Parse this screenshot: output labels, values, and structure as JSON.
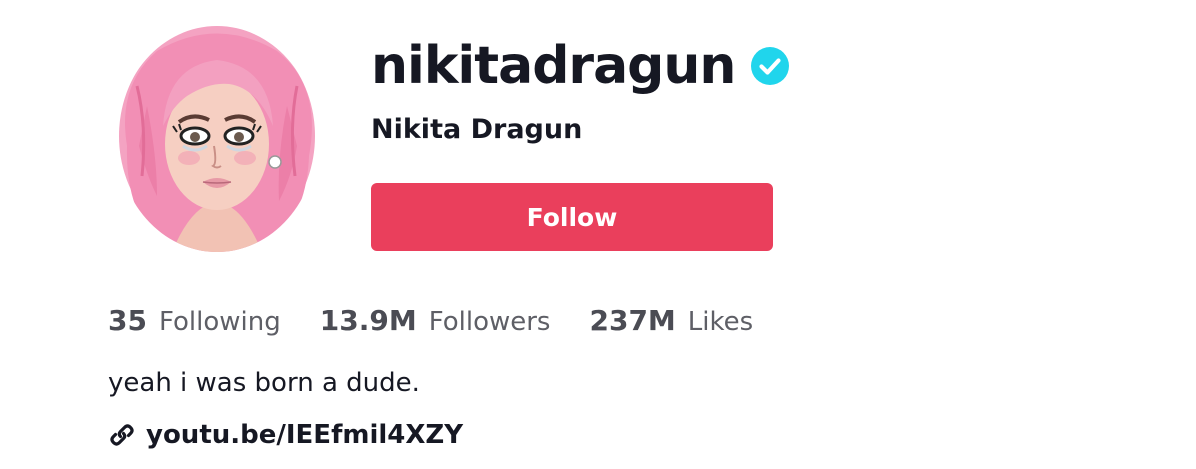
{
  "profile": {
    "username": "nikitadragun",
    "display_name": "Nikita Dragun",
    "verified": true,
    "follow_label": "Follow",
    "bio": "yeah i was born a dude.",
    "link": "youtu.be/IEEfmil4XZY",
    "stats": [
      {
        "count": "35",
        "label": "Following"
      },
      {
        "count": "13.9M",
        "label": "Followers"
      },
      {
        "count": "237M",
        "label": "Likes"
      }
    ]
  },
  "icons": {
    "verified": "verified-check-icon",
    "link": "link-icon"
  },
  "colors": {
    "follow_button": "#ea3f5c",
    "verified_badge": "#20d5ec",
    "text_primary": "#161823",
    "text_secondary": "#5e5f66"
  }
}
